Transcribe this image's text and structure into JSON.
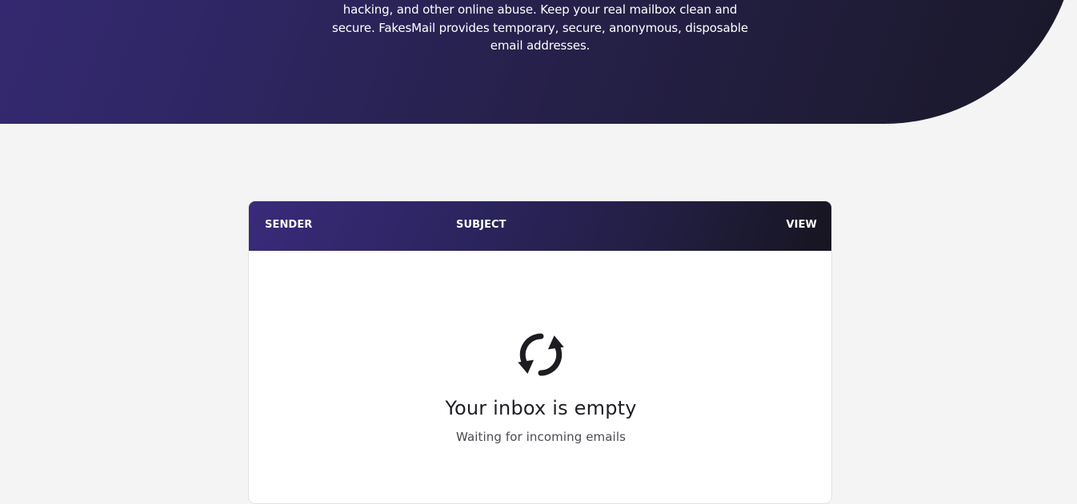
{
  "hero": {
    "description": "hacking, and other online abuse. Keep your real mailbox clean and secure. FakesMail provides temporary, secure, anonymous, disposable email addresses."
  },
  "inbox": {
    "columns": {
      "sender": "SENDER",
      "subject": "SUBJECT",
      "view": "VIEW"
    },
    "empty": {
      "icon": "refresh-icon",
      "title": "Your inbox is empty",
      "subtitle": "Waiting for incoming emails"
    }
  },
  "colors": {
    "hero_start": "#3a2a7a",
    "hero_end": "#191828",
    "background": "#f4f4f4",
    "text_dark": "#1e1e24"
  }
}
